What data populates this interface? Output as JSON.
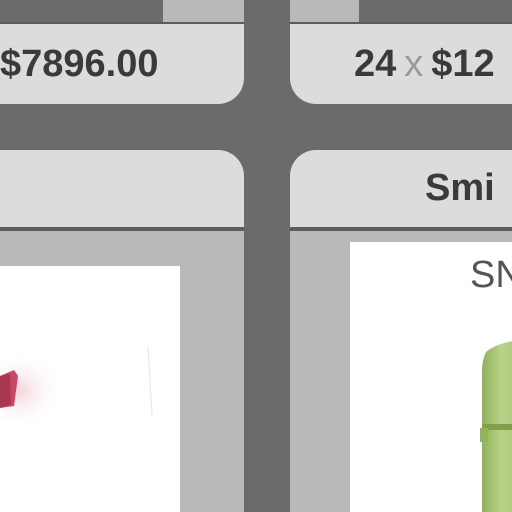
{
  "left_item": {
    "price_total": "$7896.00",
    "name": ""
  },
  "right_item": {
    "quantity": "24",
    "times_symbol": "x",
    "unit_price": "$12",
    "name": "Smi",
    "card_title": "SN"
  },
  "icons": {
    "left_product": "red-product-image",
    "right_product": "green-product-image"
  },
  "colors": {
    "background": "#6b6b6b",
    "bar": "#dcdcdc",
    "panel": "#b9b9b9",
    "text": "#3a3a3a",
    "muted": "#9a9a9a"
  }
}
